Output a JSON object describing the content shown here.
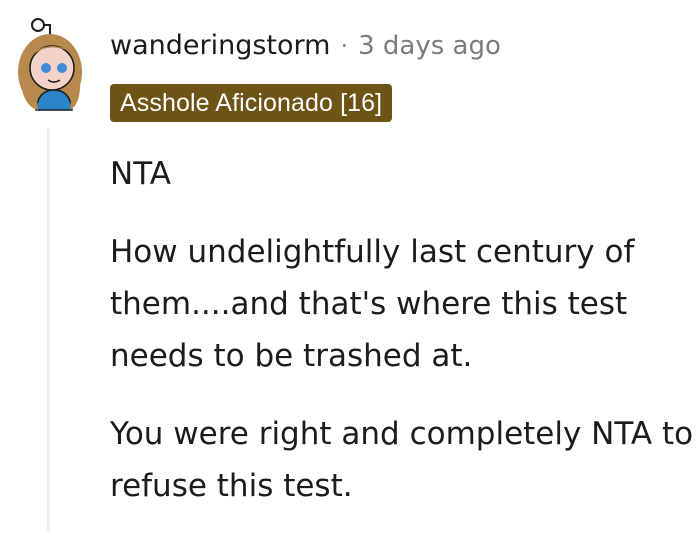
{
  "comment": {
    "author": "wanderingstorm",
    "separator": "·",
    "timestamp": "3 days ago",
    "flair": "Asshole Aficionado [16]",
    "paragraphs": [
      "NTA",
      "How undelightfully last century of them....and that's where this test needs to be trashed at.",
      "You were right and completely NTA to refuse this test."
    ]
  },
  "colors": {
    "flair_bg": "#6e5414",
    "flair_text": "#ffffff",
    "meta_text": "#7c7c7c",
    "thread_line": "#edeff1"
  },
  "icons": {
    "avatar": "snoo-avatar-icon"
  }
}
